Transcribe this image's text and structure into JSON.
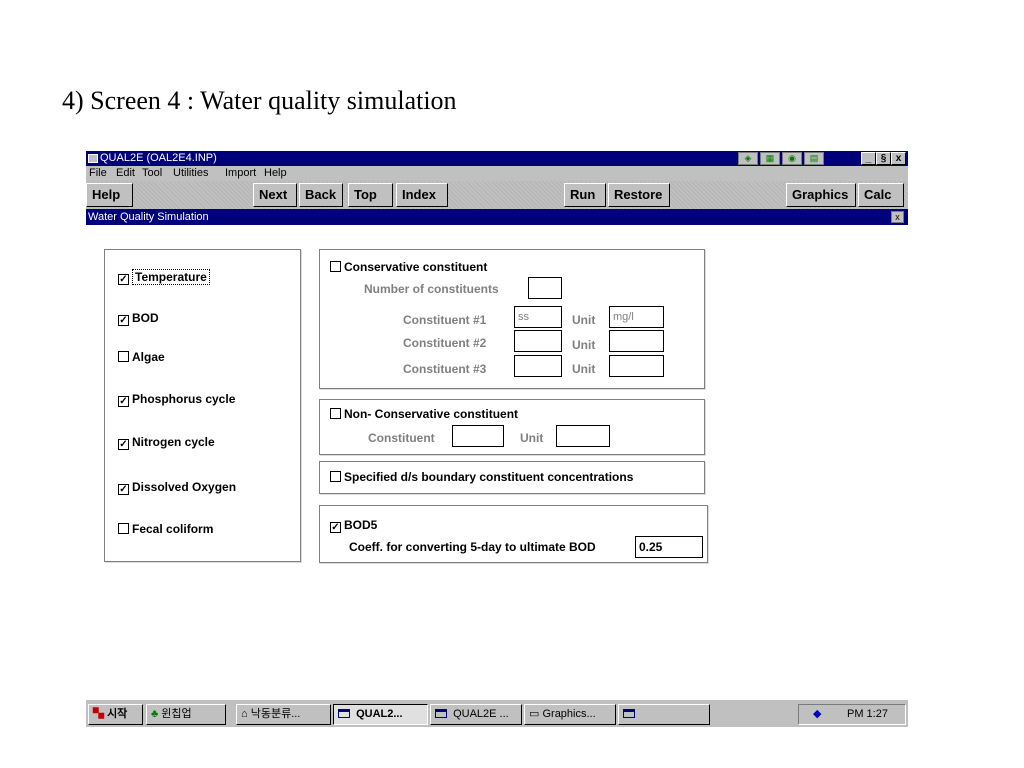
{
  "slide": {
    "title": "4) Screen 4 : Water quality simulation"
  },
  "window": {
    "title": "QUAL2E (OAL2E4.INP)",
    "tray_icons": [
      "map-icon",
      "grid-icon",
      "chart-icon",
      "file-icon"
    ],
    "controls": [
      "_",
      "§",
      "x"
    ]
  },
  "menu": [
    {
      "label": "File"
    },
    {
      "label": "Edit"
    },
    {
      "label": "Tool"
    },
    {
      "label": "Utilities"
    },
    {
      "label": "Import"
    },
    {
      "label": "Help"
    }
  ],
  "toolbar": {
    "help": "Help",
    "next": "Next",
    "back": "Back",
    "top": "Top",
    "index": "Index",
    "run": "Run",
    "restore": "Restore",
    "graphics": "Graphics",
    "calc": "Calc"
  },
  "subwindow": {
    "title": "Water Quality Simulation",
    "close": "x"
  },
  "left_panel": {
    "items": [
      {
        "label": "Temperature",
        "checked": true
      },
      {
        "label": "BOD",
        "checked": true
      },
      {
        "label": "Algae",
        "checked": false
      },
      {
        "label": "Phosphorus cycle",
        "checked": true
      },
      {
        "label": "Nitrogen cycle",
        "checked": true
      },
      {
        "label": "Dissolved Oxygen",
        "checked": true
      },
      {
        "label": "Fecal coliform",
        "checked": false
      }
    ]
  },
  "conservative": {
    "label": "Conservative constituent",
    "checked": false,
    "number_label": "Number of constituents",
    "number_value": "",
    "constituents": [
      {
        "label": "Constituent #1",
        "value": "ss",
        "unit_label": "Unit",
        "unit_value": "mg/l"
      },
      {
        "label": "Constituent #2",
        "value": "",
        "unit_label": "Unit",
        "unit_value": ""
      },
      {
        "label": "Constituent #3",
        "value": "",
        "unit_label": "Unit",
        "unit_value": ""
      }
    ]
  },
  "non_conservative": {
    "label": "Non- Conservative constituent",
    "checked": false,
    "constituent_label": "Constituent",
    "constituent_value": "",
    "unit_label": "Unit",
    "unit_value": ""
  },
  "boundary": {
    "label": "Specified d/s boundary constituent concentrations",
    "checked": false
  },
  "bod5": {
    "label": "BOD5",
    "checked": true,
    "coeff_label": "Coeff. for converting 5-day to ultimate BOD",
    "coeff_value": "0.25"
  },
  "check_mark": "✓",
  "taskbar": {
    "start": "시작",
    "buttons": [
      {
        "label": "윈칩업"
      },
      {
        "label": "낙동분류..."
      },
      {
        "label": "QUAL2...",
        "active": true
      },
      {
        "label": "QUAL2E ..."
      },
      {
        "label": "Graphics..."
      },
      {
        "label": ""
      }
    ],
    "clock": "PM 1:27"
  }
}
